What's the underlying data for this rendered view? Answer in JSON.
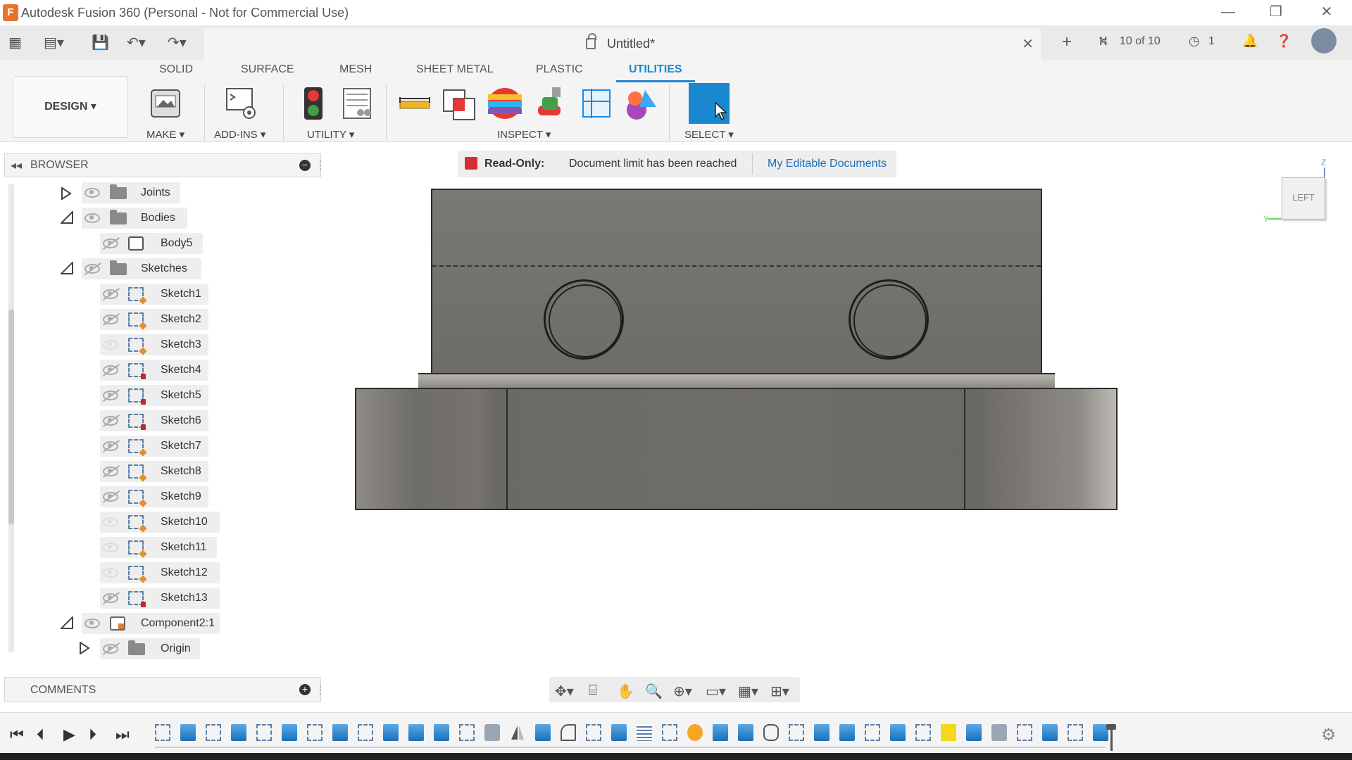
{
  "window": {
    "title": "Autodesk Fusion 360 (Personal - Not for Commercial Use)",
    "app_icon": "F"
  },
  "doc_tab": {
    "title": "Untitled*"
  },
  "quick_right": {
    "versions": "10 of 10",
    "jobs": "1"
  },
  "ribbon": {
    "tabs": [
      "SOLID",
      "SURFACE",
      "MESH",
      "SHEET METAL",
      "PLASTIC",
      "UTILITIES"
    ],
    "active_tab": "UTILITIES",
    "workspace": "DESIGN ▾",
    "groups": {
      "make": "MAKE ▾",
      "addins": "ADD-INS ▾",
      "utility": "UTILITY ▾",
      "inspect": "INSPECT ▾",
      "select": "SELECT ▾"
    }
  },
  "browser": {
    "header": "BROWSER",
    "items": [
      {
        "label": "Joints",
        "level": 1
      },
      {
        "label": "Bodies",
        "level": 1
      },
      {
        "label": "Body5",
        "level": 2
      },
      {
        "label": "Sketches",
        "level": 1
      },
      {
        "label": "Sketch1",
        "level": 2
      },
      {
        "label": "Sketch2",
        "level": 2
      },
      {
        "label": "Sketch3",
        "level": 2
      },
      {
        "label": "Sketch4",
        "level": 2
      },
      {
        "label": "Sketch5",
        "level": 2
      },
      {
        "label": "Sketch6",
        "level": 2
      },
      {
        "label": "Sketch7",
        "level": 2
      },
      {
        "label": "Sketch8",
        "level": 2
      },
      {
        "label": "Sketch9",
        "level": 2
      },
      {
        "label": "Sketch10",
        "level": 2
      },
      {
        "label": "Sketch11",
        "level": 2
      },
      {
        "label": "Sketch12",
        "level": 2
      },
      {
        "label": "Sketch13",
        "level": 2
      },
      {
        "label": "Component2:1",
        "level": 1
      },
      {
        "label": "Origin",
        "level": 2
      }
    ]
  },
  "comments": {
    "header": "COMMENTS"
  },
  "banner": {
    "title": "Read-Only:",
    "message": "Document limit has been reached",
    "link": "My Editable Documents"
  },
  "viewcube": {
    "face": "LEFT",
    "axis_z": "Z",
    "axis_y": "Y"
  },
  "colors": {
    "accent": "#1a87d1",
    "readonly_red": "#d32f2f",
    "model_gray": "#6f6d69",
    "timeline_highlight": "#f4d81a"
  }
}
